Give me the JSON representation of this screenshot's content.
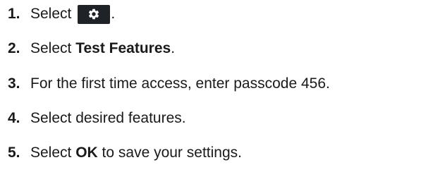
{
  "steps": [
    {
      "number": "1.",
      "text_before": "Select",
      "icon": "gear-icon",
      "text_after": "."
    },
    {
      "number": "2.",
      "text_before": "Select ",
      "bold": "Test Features",
      "text_after": "."
    },
    {
      "number": "3.",
      "text": "For the first time access, enter passcode 456."
    },
    {
      "number": "4.",
      "text": "Select desired features."
    },
    {
      "number": "5.",
      "text_before": "Select ",
      "bold": "OK",
      "text_after": " to save your settings."
    }
  ],
  "colors": {
    "text": "#1a1a1a",
    "icon_background": "#1f2327",
    "icon_foreground": "#ffffff"
  }
}
